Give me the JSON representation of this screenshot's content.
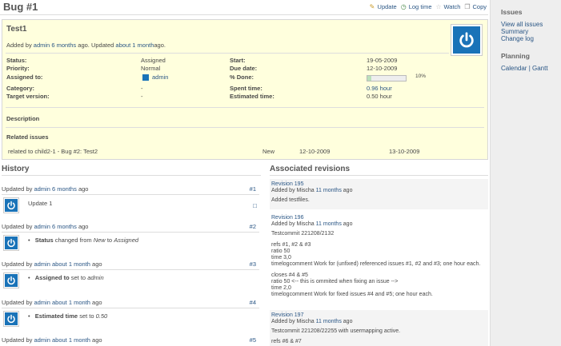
{
  "page": {
    "title": "Bug #1",
    "actions": [
      {
        "label": "Update",
        "icon": "pencil-icon"
      },
      {
        "label": "Log time",
        "icon": "clock-icon"
      },
      {
        "label": "Watch",
        "icon": "star-icon"
      },
      {
        "label": "Copy",
        "icon": "copy-icon"
      }
    ]
  },
  "issue": {
    "subject": "Test1",
    "author_prefix": "Added by",
    "author": "admin",
    "created_ago": "6 months",
    "mid": "ago. Updated",
    "updated_ago": "about 1 month",
    "suffix": "ago.",
    "left_attrs": [
      {
        "key": "Status:",
        "value": "Assigned"
      },
      {
        "key": "Priority:",
        "value": "Normal"
      },
      {
        "key": "Assigned to:",
        "value": "admin"
      },
      {
        "key": "Category:",
        "value": "-"
      },
      {
        "key": "Target version:",
        "value": "-"
      }
    ],
    "right_attrs": [
      {
        "key": "Start:",
        "value": "19-05-2009"
      },
      {
        "key": "Due date:",
        "value": "12-10-2009"
      },
      {
        "key": "% Done:",
        "value": "10%"
      },
      {
        "key": "Spent time:",
        "value": "0.96 hour"
      },
      {
        "key": "Estimated time:",
        "value": "0.50 hour"
      }
    ],
    "done_ratio": 0.1,
    "description_label": "Description",
    "related_label": "Related issues",
    "relation": {
      "text": "related to child2-1 - Bug #2: Test2",
      "status": "New",
      "start": "12-10-2009",
      "due": "13-10-2009"
    }
  },
  "history": {
    "title": "History",
    "entries": [
      {
        "prefix": "Updated by",
        "user": "admin",
        "ago": "6 months",
        "suffix": "ago",
        "num": "#1",
        "note": "Update 1"
      },
      {
        "prefix": "Updated by",
        "user": "admin",
        "ago": "6 months",
        "suffix": "ago",
        "num": "#2",
        "field": "Status",
        "mid": "changed from",
        "old": "New",
        "to": "to",
        "new": "Assigned"
      },
      {
        "prefix": "Updated by",
        "user": "admin",
        "ago": "about 1 month",
        "suffix": "ago",
        "num": "#3",
        "field": "Assigned to",
        "mid": "set to",
        "new": "admin"
      },
      {
        "prefix": "Updated by",
        "user": "admin",
        "ago": "about 1 month",
        "suffix": "ago",
        "num": "#4",
        "field": "Estimated time",
        "mid": "set to",
        "new": "0.50"
      },
      {
        "prefix": "Updated by",
        "user": "admin",
        "ago": "about 1 month",
        "suffix": "ago",
        "num": "#5"
      }
    ]
  },
  "revisions": {
    "title": "Associated revisions",
    "items": [
      {
        "name": "Revision 195",
        "by": "Added by Mischa",
        "ago": "11 months",
        "suffix": "ago",
        "lines": [
          "Added testfiles."
        ]
      },
      {
        "name": "Revision 196",
        "by": "Added by Mischa",
        "ago": "11 months",
        "suffix": "ago",
        "lines": [
          "Testcommit 221208/2132",
          "refs #1, #2 & #3",
          "ratio 50",
          "time 3,0",
          "timelogcomment Work for (unfixed) referenced issues #1, #2 and #3; one hour each.",
          "closes #4 & #5",
          "ratio 50 <-- this is ommited when fixing an issue -->",
          "time 2,0",
          "timelogcomment Work for fixed issues #4 and #5; one hour each."
        ]
      },
      {
        "name": "Revision 197",
        "by": "Added by Mischa",
        "ago": "11 months",
        "suffix": "ago",
        "lines": [
          "Testcommit 221208/22255 with usermapping active.",
          "refs #6 & #7"
        ]
      }
    ]
  },
  "sidebar": {
    "issues_title": "Issues",
    "issues_links": [
      "View all issues",
      "Summary",
      "Change log"
    ],
    "planning_title": "Planning",
    "planning_text": "Calendar | Gantt"
  },
  "colors": {
    "issue_background": "#FFFFDD",
    "link": "#2A5685",
    "avatar": "#1A73B8",
    "progress_fill": "#BAE0BA"
  }
}
